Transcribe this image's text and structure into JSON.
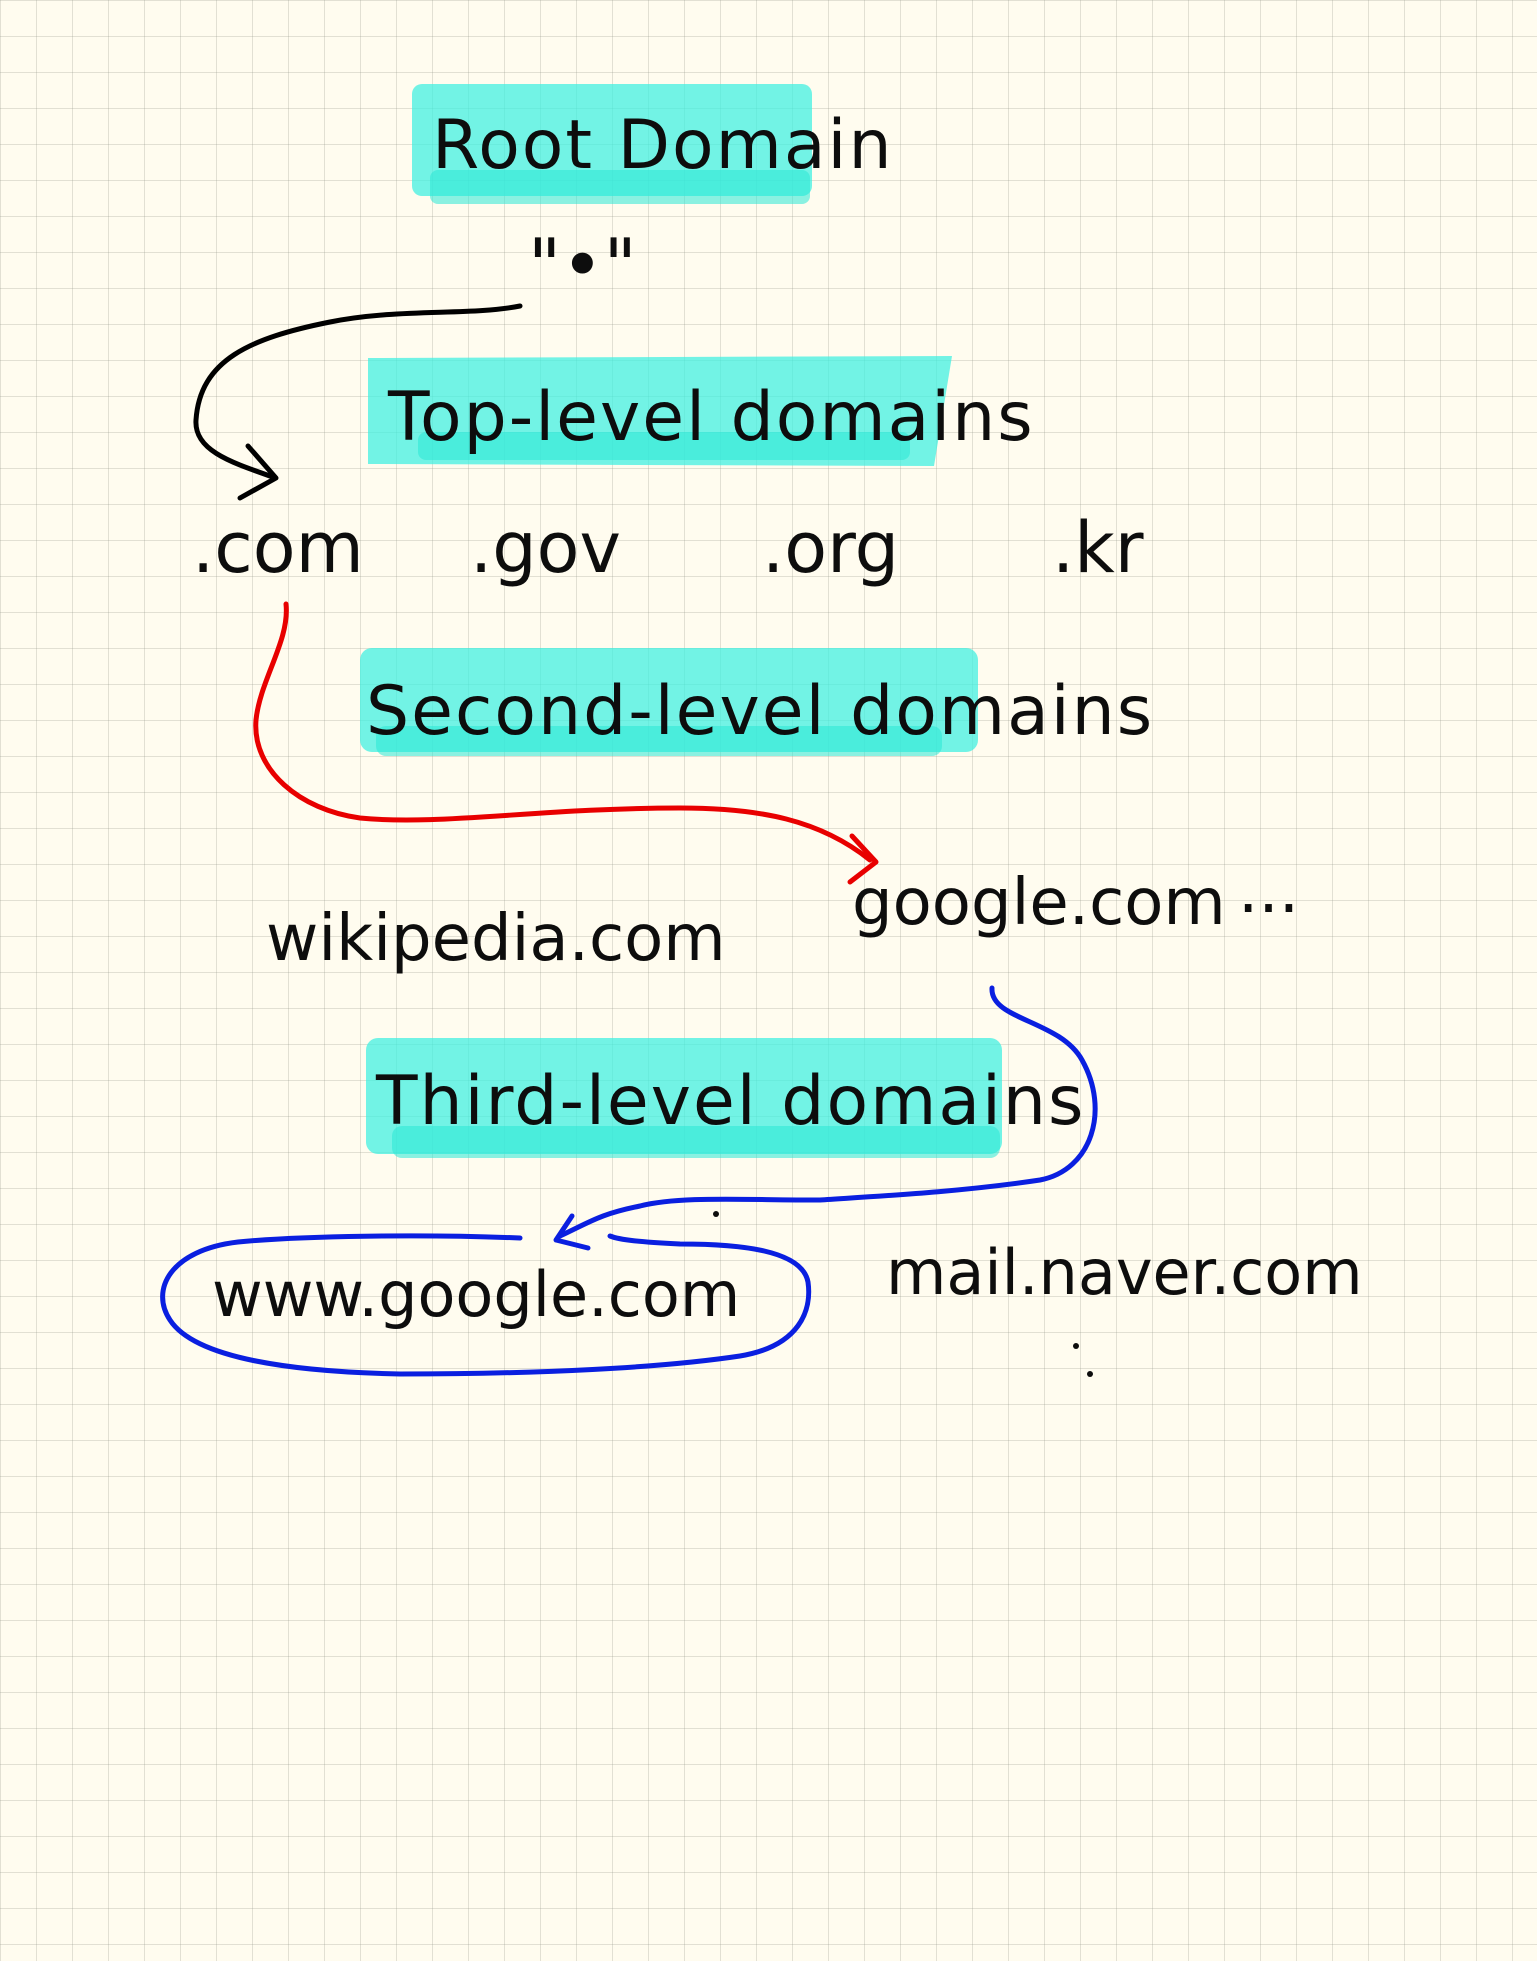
{
  "levels": {
    "root": {
      "heading": "Root Domain",
      "symbol": "\"•\""
    },
    "top": {
      "heading": "Top-level domains",
      "items": [
        ".com",
        ".gov",
        ".org",
        ".kr"
      ]
    },
    "second": {
      "heading": "Second-level domains",
      "items": [
        "wikipedia.com",
        "google.com",
        "..."
      ]
    },
    "third": {
      "heading": "Third-level domains",
      "items": [
        "www.google.com",
        "mail.naver.com"
      ]
    }
  },
  "colors": {
    "highlight": "#3cf0e0",
    "arrow_root": "#000000",
    "arrow_second": "#e80000",
    "arrow_third": "#0a1fe0",
    "ink": "#0d0d0d",
    "paper": "#fffcef"
  }
}
